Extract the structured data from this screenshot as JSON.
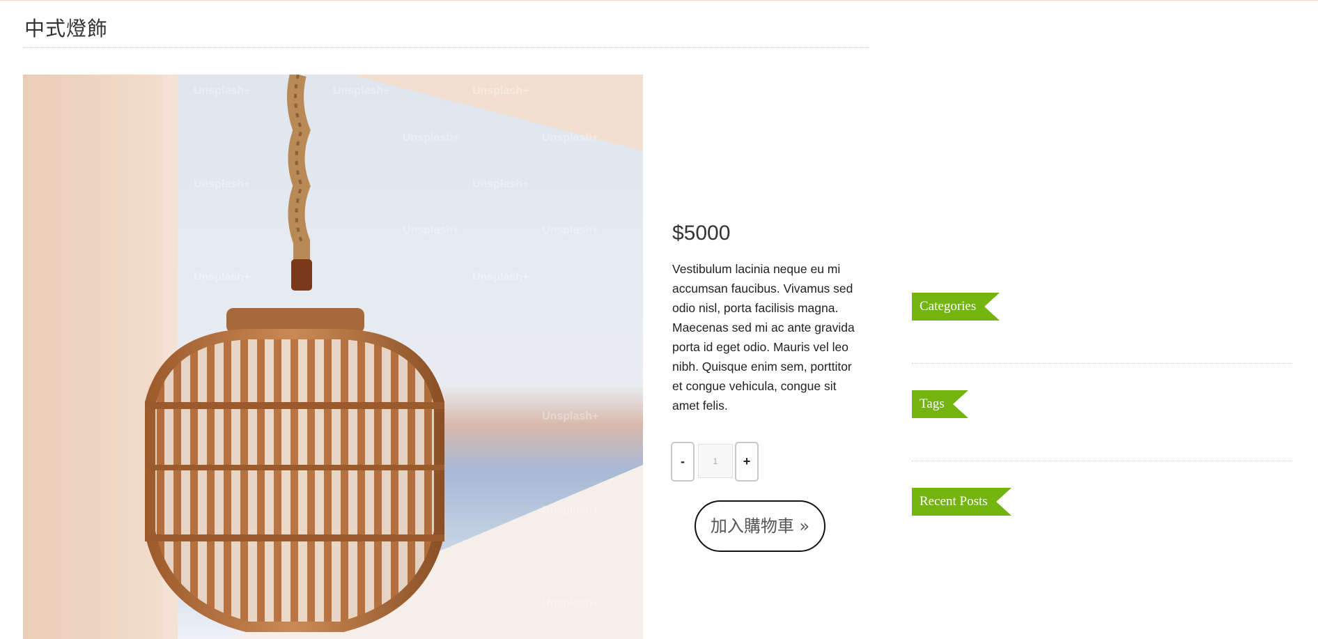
{
  "page": {
    "title": "中式燈飾"
  },
  "product": {
    "image_alt": "Rattan lantern pendant hanging from rope",
    "watermark": "Unsplash+",
    "price": "$5000",
    "description": "Vestibulum lacinia neque eu mi accumsan faucibus. Vivamus sed odio nisl, porta facilisis magna. Maecenas sed mi ac ante gravida porta id eget odio. Mauris vel leo nibh. Quisque enim sem, porttitor et congue vehicula, congue sit amet felis.",
    "quantity": {
      "minus_label": "-",
      "plus_label": "+",
      "value": "1"
    },
    "add_to_cart_label": "加入購物車 »"
  },
  "sidebar": {
    "widgets": [
      {
        "title": "Categories"
      },
      {
        "title": "Tags"
      },
      {
        "title": "Recent Posts"
      }
    ]
  },
  "colors": {
    "accent_green": "#74b40e",
    "text": "#333333",
    "divider": "#cccccc"
  }
}
